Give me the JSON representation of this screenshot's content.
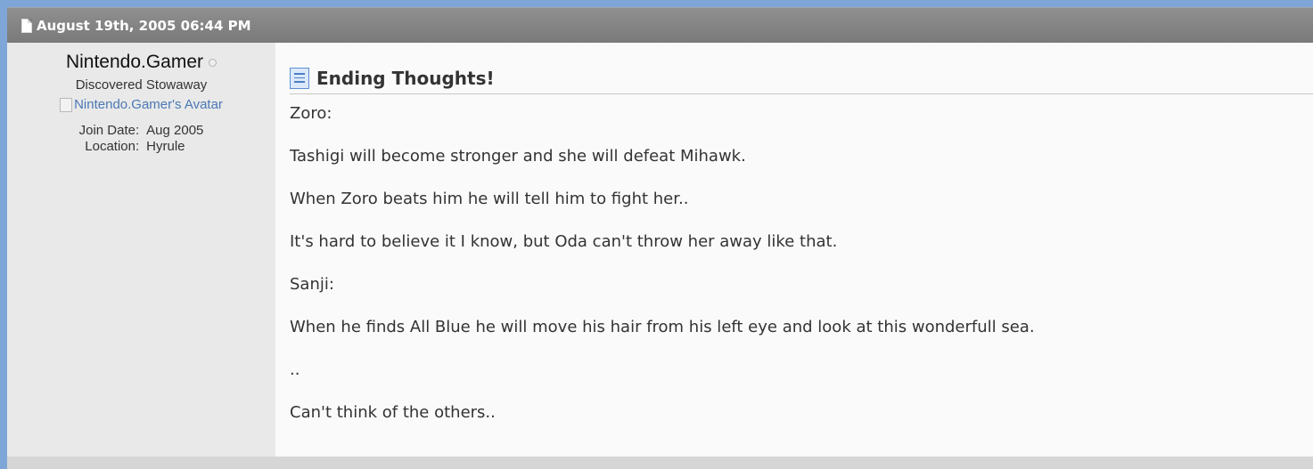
{
  "post": {
    "date": "August 19th, 2005 06:44 PM",
    "title": "Ending Thoughts!"
  },
  "user": {
    "name": "Nintendo.Gamer",
    "user_title": "Discovered Stowaway",
    "avatar_alt": "Nintendo.Gamer's Avatar",
    "stats": [
      {
        "label": "Join Date:",
        "value": "Aug 2005"
      },
      {
        "label": "Location:",
        "value": "Hyrule"
      }
    ]
  },
  "message": {
    "lines": [
      "Zoro:",
      "Tashigi will become stronger and she will defeat Mihawk.",
      "When Zoro beats him he will tell him to fight her..",
      "It's hard to believe it I know, but Oda can't throw her away like that.",
      "Sanji:",
      "When he finds All Blue he will move his hair from his left eye and look at this wonderfull sea.",
      "..",
      "Can't think of the others.."
    ]
  },
  "icons": {
    "date_icon": "document-icon",
    "title_icon": "blue-document-icon",
    "status_icon": "offline-status-icon",
    "avatar_icon": "broken-image-icon"
  },
  "colors": {
    "page_background": "#7ea7d8",
    "header_bar": "#858585",
    "sidebar": "#e9e9e9",
    "content": "#fafafa",
    "link": "#4a78b5"
  }
}
